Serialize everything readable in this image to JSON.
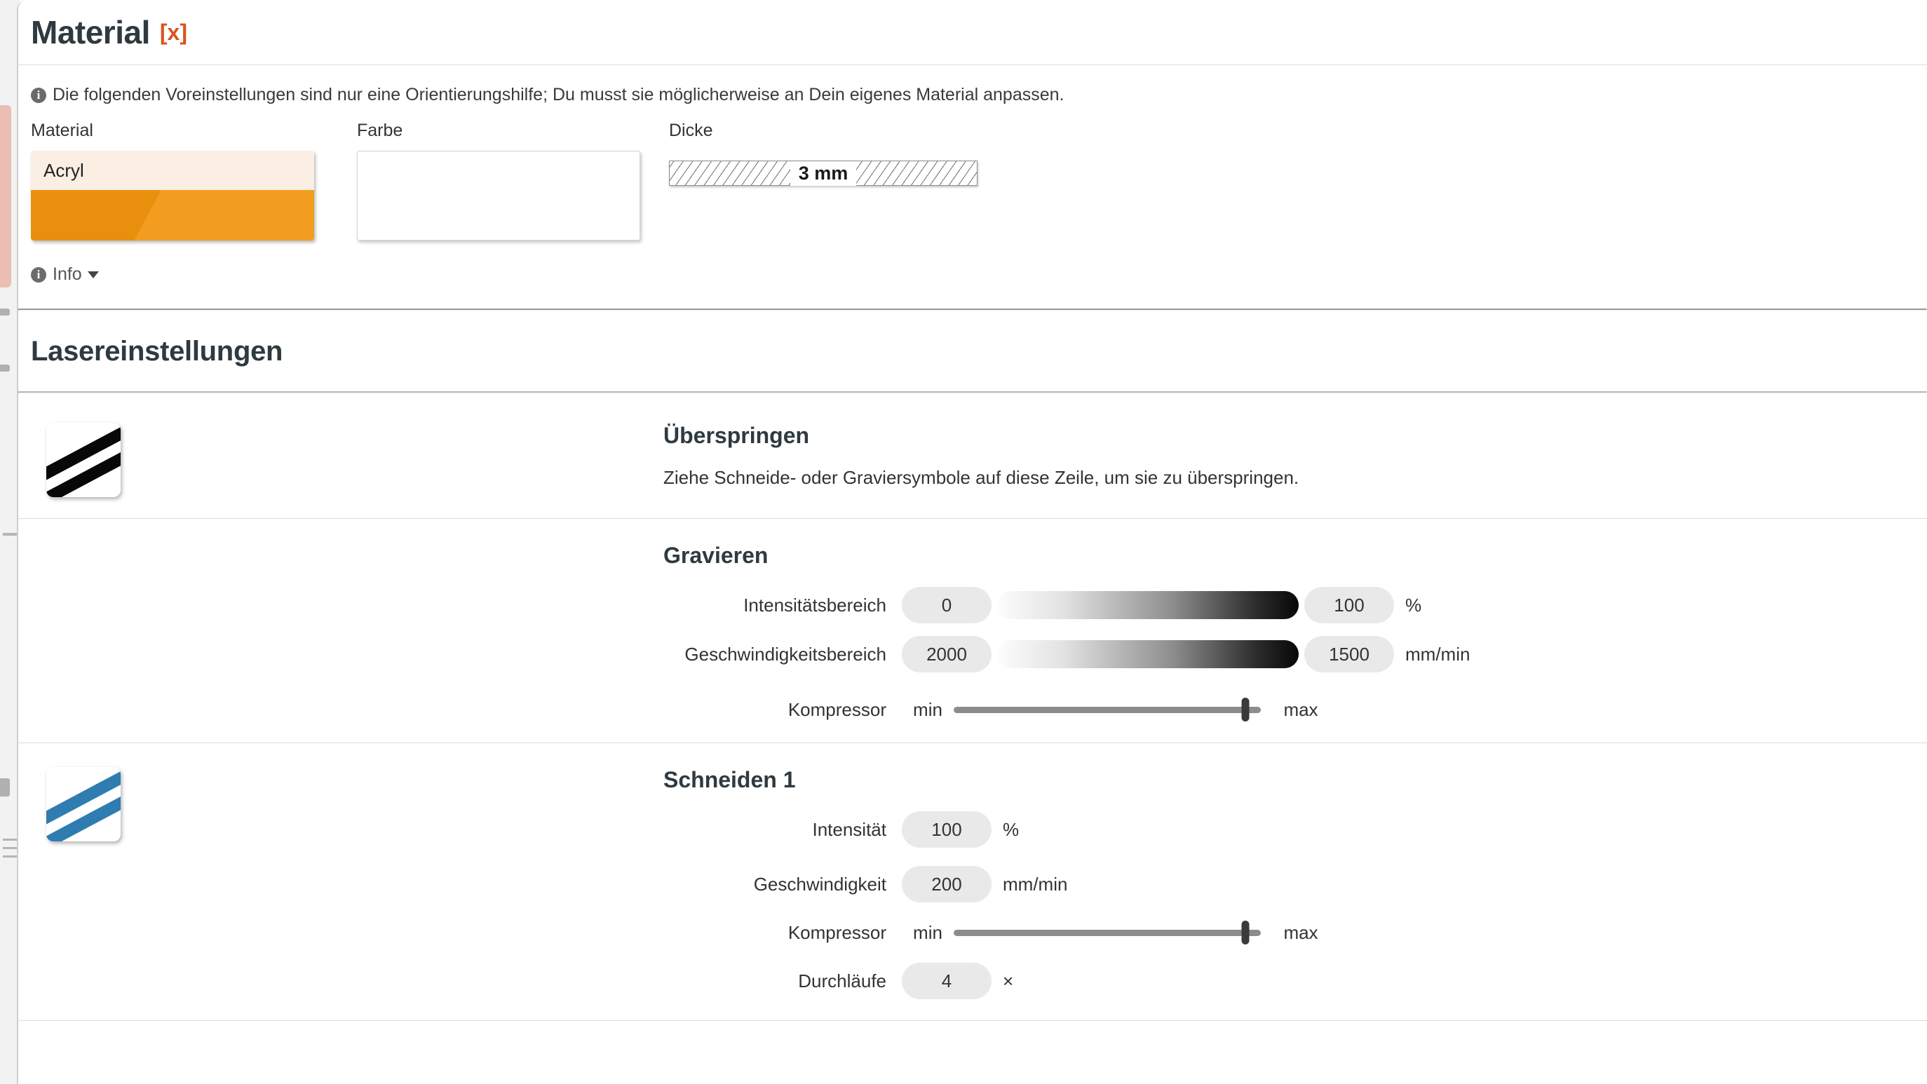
{
  "header": {
    "title": "Material",
    "close_label": "[x]"
  },
  "info_banner": {
    "icon": "info-circle-icon",
    "text": "Die folgenden Voreinstellungen sind nur eine Orientierungshilfe; Du musst sie möglicherweise an Dein eigenes Material anpassen."
  },
  "material_row": {
    "material": {
      "label": "Material",
      "value": "Acryl",
      "swatch_color": "#f2960f",
      "card_top_color": "#fbeee2"
    },
    "farbe": {
      "label": "Farbe",
      "value": ""
    },
    "dicke": {
      "label": "Dicke",
      "value": "3 mm"
    }
  },
  "info_toggle": {
    "icon": "info-circle-icon",
    "label": "Info",
    "caret": "chevron-down-icon"
  },
  "laser_settings": {
    "heading": "Lasereinstellungen",
    "operations": [
      {
        "id": "skip",
        "icon": "diagonal-stripes-icon",
        "stripe_color": "#080808",
        "title": "Überspringen",
        "description": "Ziehe Schneide- oder Graviersymbole auf diese Zeile, um sie zu überspringen."
      },
      {
        "id": "engrave",
        "title": "Gravieren",
        "controls": [
          {
            "type": "range",
            "label": "Intensitätsbereich",
            "from": "0",
            "to": "100",
            "unit": "%"
          },
          {
            "type": "range",
            "label": "Geschwindigkeitsbereich",
            "from": "2000",
            "to": "1500",
            "unit": "mm/min"
          },
          {
            "type": "slider",
            "label": "Kompressor",
            "min_label": "min",
            "max_label": "max",
            "value_percent": 95
          }
        ]
      },
      {
        "id": "cut1",
        "icon": "diagonal-stripes-icon",
        "stripe_color": "#2f7cb0",
        "title": "Schneiden 1",
        "controls": [
          {
            "type": "value",
            "label": "Intensität",
            "value": "100",
            "unit": "%"
          },
          {
            "type": "value",
            "label": "Geschwindigkeit",
            "value": "200",
            "unit": "mm/min"
          },
          {
            "type": "slider",
            "label": "Kompressor",
            "min_label": "min",
            "max_label": "max",
            "value_percent": 95
          },
          {
            "type": "value",
            "label": "Durchläufe",
            "value": "4",
            "unit": "×"
          }
        ]
      }
    ]
  },
  "colors": {
    "accent_orange": "#d9531e",
    "material_orange": "#f2960f",
    "cut_blue": "#2f7cb0",
    "heading": "#2f3a40"
  }
}
